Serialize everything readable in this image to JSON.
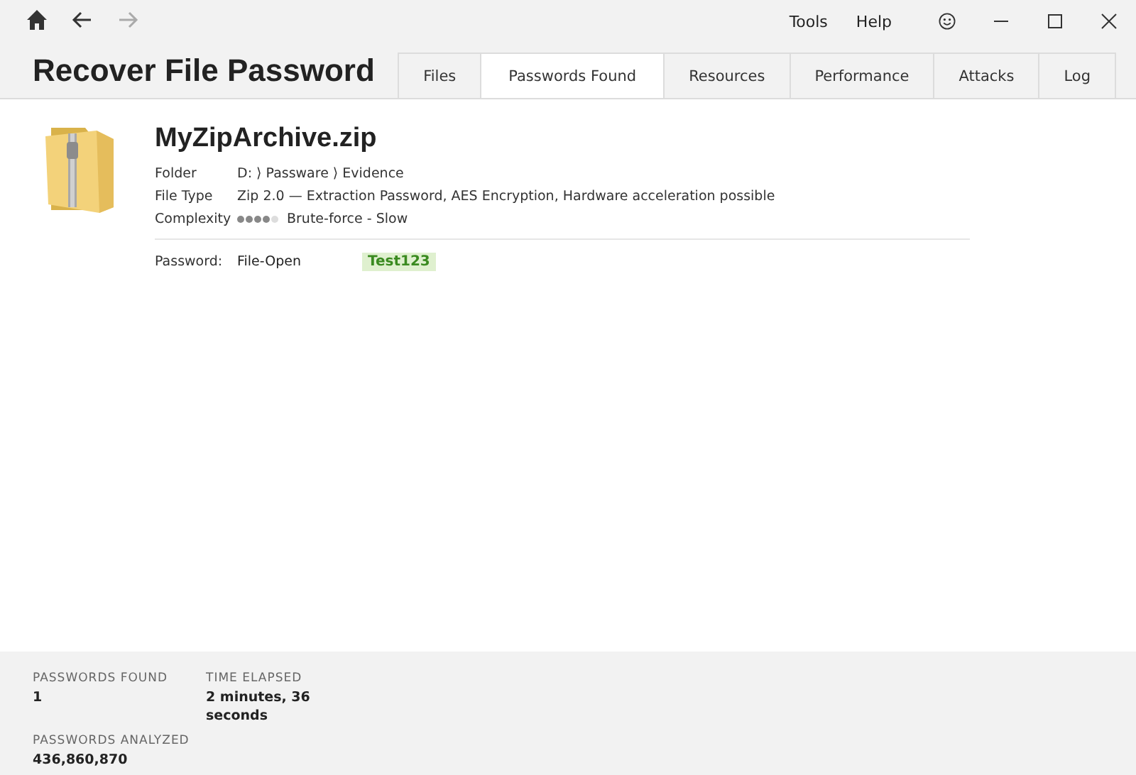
{
  "nav": [
    {
      "kind": "home",
      "disabled": false
    },
    {
      "kind": "back",
      "disabled": false
    },
    {
      "kind": "forward",
      "disabled": true
    }
  ],
  "menu": [
    "Tools",
    "Help"
  ],
  "title": "Recover File Password",
  "tabs": [
    {
      "label": "Files",
      "selected": false
    },
    {
      "label": "Passwords Found",
      "selected": true
    },
    {
      "label": "Resources",
      "selected": false
    },
    {
      "label": "Performance",
      "selected": false
    },
    {
      "label": "Attacks",
      "selected": false
    },
    {
      "label": "Log",
      "selected": false
    }
  ],
  "file": {
    "name": "MyZipArchive.zip",
    "details": [
      {
        "label": "Folder",
        "value": "D: ⟩ Passware ⟩ Evidence"
      },
      {
        "label": "File Type",
        "value": "Zip 2.0 — Extraction Password, AES Encryption, Hardware acceleration possible"
      },
      {
        "label": "Complexity",
        "stars": 4,
        "value": "Brute-force - Slow"
      }
    ],
    "password": {
      "label": "Password:",
      "type": "File-Open",
      "value": "Test123"
    }
  },
  "stats": [
    {
      "label": "PASSWORDS FOUND",
      "value": "1"
    },
    {
      "label": "TIME ELAPSED",
      "value": "2 minutes, 36 seconds"
    },
    {
      "label": "PASSWORDS ANALYZED",
      "value": "436,860,870"
    }
  ]
}
